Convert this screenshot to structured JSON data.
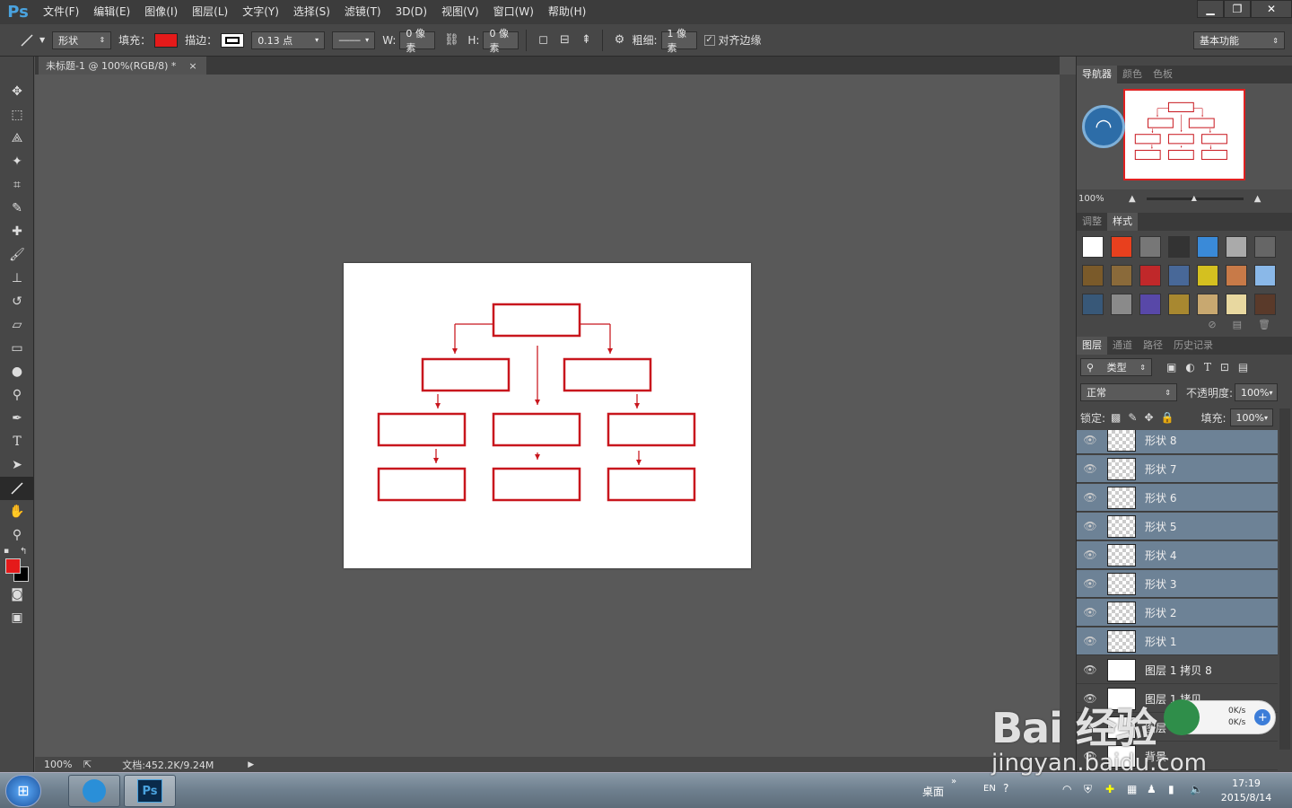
{
  "app": {
    "logo": "Ps"
  },
  "menu": [
    "文件(F)",
    "编辑(E)",
    "图像(I)",
    "图层(L)",
    "文字(Y)",
    "选择(S)",
    "滤镜(T)",
    "3D(D)",
    "视图(V)",
    "窗口(W)",
    "帮助(H)"
  ],
  "window_buttons": {
    "minimize": "▁",
    "restore": "❐",
    "close": "✕"
  },
  "options": {
    "mode": "形状",
    "fill_label": "填充：",
    "fill_color": "#e51a1a",
    "stroke_label": "描边：",
    "stroke_width": "0.13 点",
    "w_label": "W:",
    "w_value": "0 像素",
    "h_label": "H:",
    "h_value": "0 像素",
    "weight_label": "粗细:",
    "weight_value": "1 像素",
    "align_edges_label": "对齐边缘",
    "align_edges_checked": true,
    "workspace": "基本功能"
  },
  "document": {
    "tab_title": "未标题-1 @ 100%(RGB/8) *",
    "zoom": "100%",
    "doc_info": "文档:452.2K/9.24M",
    "shape_color": "#c8161d"
  },
  "colors": {
    "foreground": "#e51a1a",
    "background": "#000000",
    "accent": "#6d8296"
  },
  "navigator": {
    "tabs": [
      "导航器",
      "颜色",
      "色板"
    ],
    "zoom": "100%"
  },
  "styles_panel": {
    "tabs": [
      "调整",
      "样式"
    ]
  },
  "layers_panel": {
    "tabs": [
      "图层",
      "通道",
      "路径",
      "历史记录"
    ],
    "filter": "类型",
    "blend_mode": "正常",
    "opacity_label": "不透明度:",
    "opacity": "100%",
    "lock_label": "锁定:",
    "fill_label": "填充:",
    "fill": "100%",
    "layers": [
      {
        "name": "形状 8",
        "selected": true,
        "thumb": "checker"
      },
      {
        "name": "形状 7",
        "selected": true,
        "thumb": "checker"
      },
      {
        "name": "形状 6",
        "selected": true,
        "thumb": "checker"
      },
      {
        "name": "形状 5",
        "selected": true,
        "thumb": "checker"
      },
      {
        "name": "形状 4",
        "selected": true,
        "thumb": "checker"
      },
      {
        "name": "形状 3",
        "selected": true,
        "thumb": "checker"
      },
      {
        "name": "形状 2",
        "selected": true,
        "thumb": "checker"
      },
      {
        "name": "形状 1",
        "selected": true,
        "thumb": "checker"
      },
      {
        "name": "图层 1 拷贝 8",
        "selected": false,
        "thumb": "white"
      },
      {
        "name": "图层 1 拷贝",
        "selected": false,
        "thumb": "white"
      },
      {
        "name": "图层",
        "selected": false,
        "thumb": "white"
      },
      {
        "name": "背景",
        "selected": false,
        "thumb": "white"
      }
    ]
  },
  "netspeed": {
    "up": "0K/s",
    "down": "0K/s"
  },
  "taskbar": {
    "desktop_label": "桌面",
    "lang": "EN",
    "time": "17:19",
    "date": "2015/8/14"
  },
  "watermark": {
    "brand": "Bai 经验",
    "url": "jingyan.baidu.com"
  }
}
